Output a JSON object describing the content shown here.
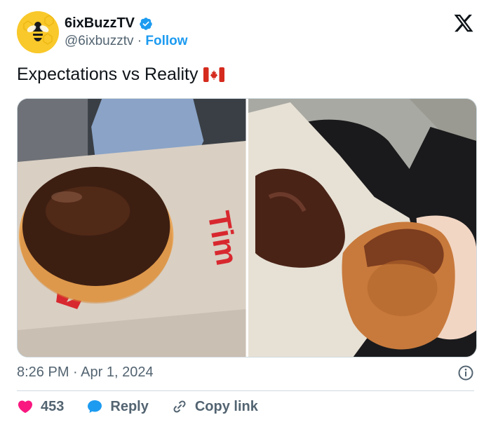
{
  "author": {
    "display_name": "6ixBuzzTV",
    "handle": "@6ixbuzztv",
    "separator": "·",
    "follow_label": "Follow",
    "verified": true
  },
  "tweet": {
    "text": "Expectations vs Reality",
    "flag_icon": "canada-flag-icon",
    "media": [
      {
        "name": "expectation-photo",
        "description_icon": "chocolate-donut-photo"
      },
      {
        "name": "reality-photo",
        "description_icon": "eaten-donut-photo"
      }
    ]
  },
  "meta": {
    "timestamp": "8:26 PM · Apr 1, 2024"
  },
  "actions": {
    "like_count": "453",
    "reply_label": "Reply",
    "copy_link_label": "Copy link"
  },
  "colors": {
    "accent": "#1d9bf0",
    "like": "#f91880",
    "secondary_text": "#536471",
    "border": "#cfd9de"
  }
}
